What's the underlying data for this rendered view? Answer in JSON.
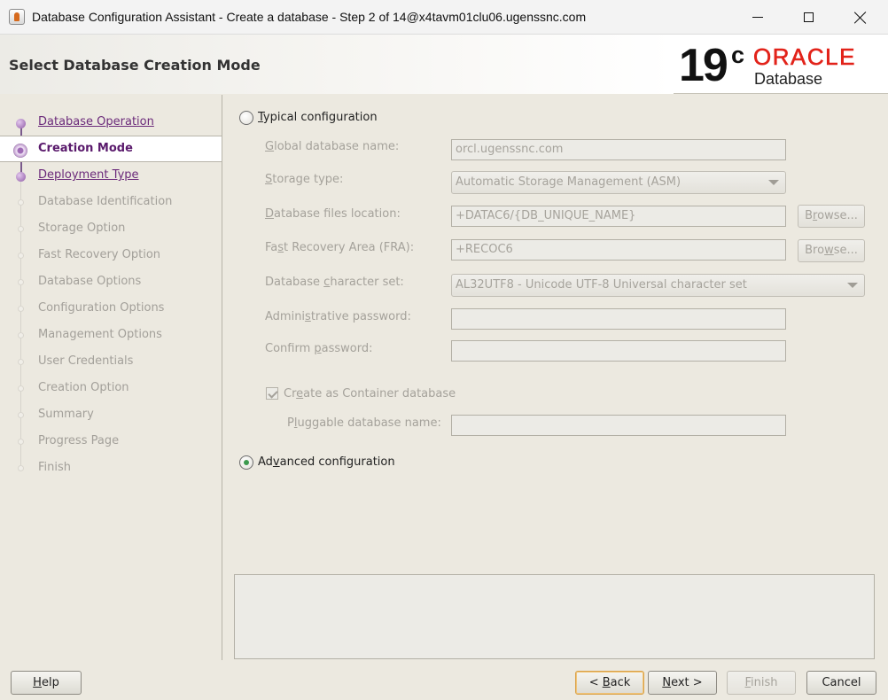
{
  "window": {
    "title": "Database Configuration Assistant - Create a database - Step 2 of 14@x4tavm01clu06.ugenssnc.com",
    "app_icon": "java-coffee-cup-icon",
    "controls": [
      "minimize-icon",
      "maximize-icon",
      "close-icon"
    ]
  },
  "header": {
    "title": "Select Database Creation Mode",
    "logo": {
      "version": "19",
      "version_suffix": "c",
      "brand": "ORACLE",
      "product": "Database"
    }
  },
  "steps": [
    {
      "label": "Database Operation",
      "state": "done"
    },
    {
      "label": "Creation Mode",
      "state": "current"
    },
    {
      "label": "Deployment Type",
      "state": "done"
    },
    {
      "label": "Database Identification",
      "state": "pending"
    },
    {
      "label": "Storage Option",
      "state": "pending"
    },
    {
      "label": "Fast Recovery Option",
      "state": "pending"
    },
    {
      "label": "Database Options",
      "state": "pending"
    },
    {
      "label": "Configuration Options",
      "state": "pending"
    },
    {
      "label": "Management Options",
      "state": "pending"
    },
    {
      "label": "User Credentials",
      "state": "pending"
    },
    {
      "label": "Creation Option",
      "state": "pending"
    },
    {
      "label": "Summary",
      "state": "pending"
    },
    {
      "label": "Progress Page",
      "state": "pending"
    },
    {
      "label": "Finish",
      "state": "pending"
    }
  ],
  "typical": {
    "label_mnemonic": "T",
    "label_rest": "ypical configuration",
    "selected": false,
    "global_db_name": {
      "label_pre": "",
      "label_mnemonic": "G",
      "label_post": "lobal database name:",
      "value": "orcl.ugenssnc.com"
    },
    "storage_type": {
      "label_pre": "",
      "label_mnemonic": "S",
      "label_post": "torage type:",
      "value": "Automatic Storage Management (ASM)"
    },
    "db_files_location": {
      "label_pre": "",
      "label_mnemonic": "D",
      "label_post": "atabase files location:",
      "value": "+DATAC6/{DB_UNIQUE_NAME}",
      "browse_pre": "B",
      "browse_mnemonic": "r",
      "browse_post": "owse..."
    },
    "fra": {
      "label_pre": "Fa",
      "label_mnemonic": "s",
      "label_post": "t Recovery Area (FRA):",
      "value": "+RECOC6",
      "browse_pre": "Bro",
      "browse_mnemonic": "w",
      "browse_post": "se..."
    },
    "charset": {
      "label_pre": "Database ",
      "label_mnemonic": "c",
      "label_post": "haracter set:",
      "value": "AL32UTF8 - Unicode UTF-8 Universal character set"
    },
    "admin_password": {
      "label_pre": "Admini",
      "label_mnemonic": "s",
      "label_post": "trative password:",
      "value": ""
    },
    "confirm_password": {
      "label_pre": "Confirm ",
      "label_mnemonic": "p",
      "label_post": "assword:",
      "value": ""
    },
    "container_db": {
      "label_pre": "Cr",
      "label_mnemonic": "e",
      "label_post": "ate as Container database",
      "checked": true
    },
    "pdb_name": {
      "label_pre": "P",
      "label_mnemonic": "l",
      "label_post": "uggable database name:",
      "value": ""
    }
  },
  "advanced": {
    "label_pre": "Ad",
    "label_mnemonic": "v",
    "label_post": "anced configuration",
    "selected": true
  },
  "buttons": {
    "help": {
      "mnemonic": "H",
      "rest": "elp"
    },
    "back": {
      "pre": "< ",
      "mnemonic": "B",
      "rest": "ack"
    },
    "next": {
      "mnemonic": "N",
      "rest": "ext >"
    },
    "finish": {
      "mnemonic": "F",
      "rest": "inish"
    },
    "cancel": {
      "label": "Cancel"
    }
  },
  "colors": {
    "accent_purple": "#6b2a7a",
    "oracle_red": "#e2231a",
    "radio_selected": "#3c9a4e",
    "focus_orange": "#d9a24a"
  }
}
